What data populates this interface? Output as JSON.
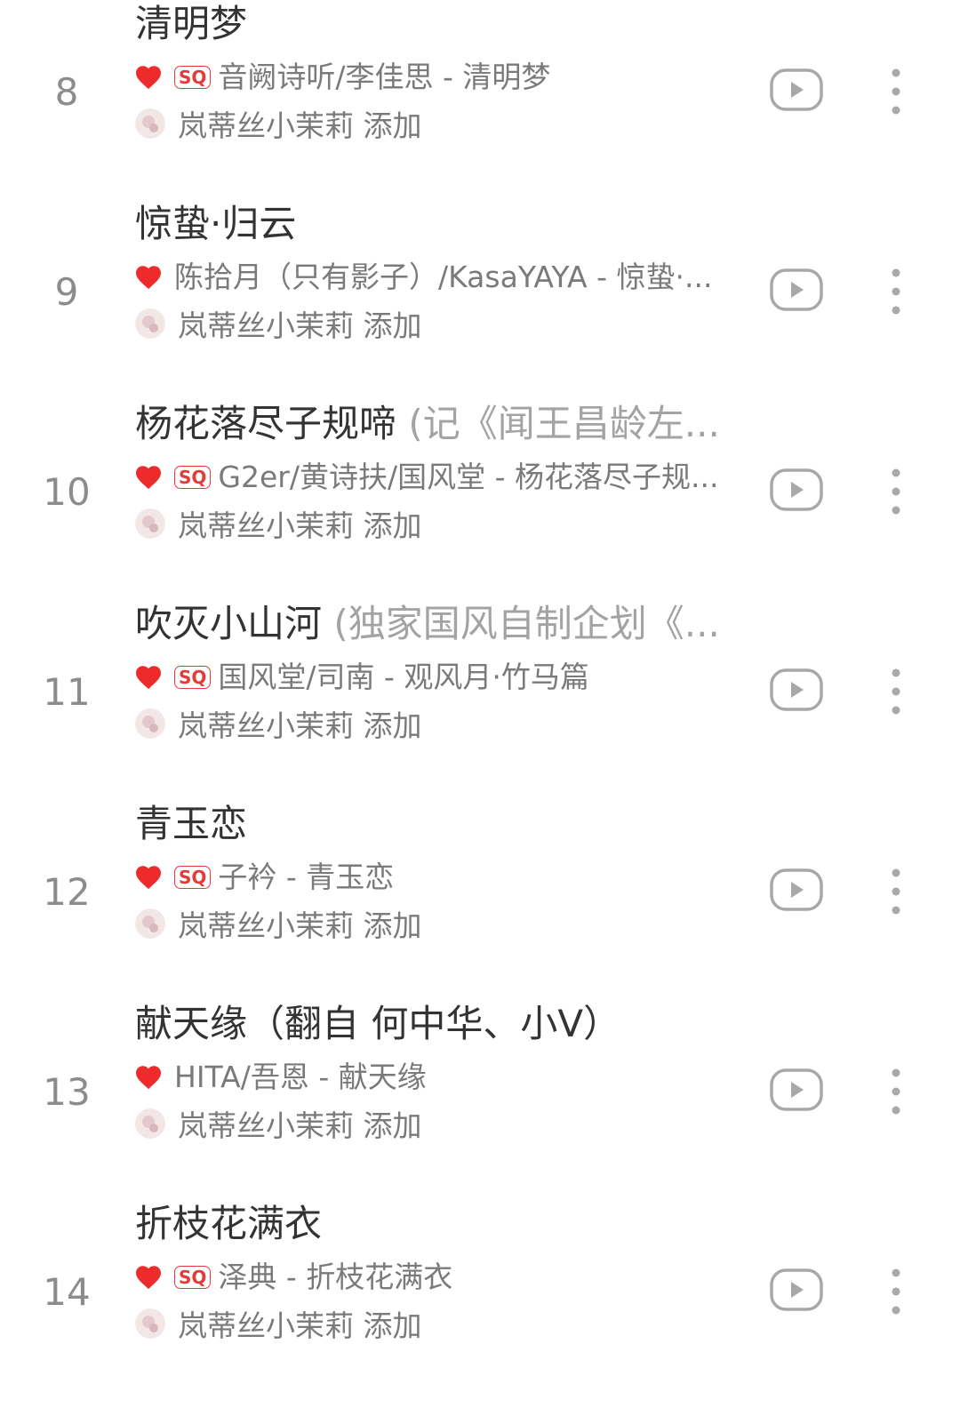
{
  "songs": [
    {
      "index": "8",
      "title": "清明梦",
      "subtitle": "",
      "sq": true,
      "artist": "音阙诗听/李佳思 - 清明梦",
      "added_by": "岚蒂丝小茉莉",
      "added_label": "添加"
    },
    {
      "index": "9",
      "title": "惊蛰·归云",
      "subtitle": "",
      "sq": false,
      "artist": "陈拾月（只有影子）/KasaYAYA - 惊蛰·...",
      "added_by": "岚蒂丝小茉莉",
      "added_label": "添加"
    },
    {
      "index": "10",
      "title": "杨花落尽子规啼",
      "subtitle": "(记《闻王昌龄左...",
      "sq": true,
      "artist": "G2er/黄诗扶/国风堂 - 杨花落尽子规...",
      "added_by": "岚蒂丝小茉莉",
      "added_label": "添加"
    },
    {
      "index": "11",
      "title": "吹灭小山河",
      "subtitle": "(独家国风自制企划《...",
      "sq": true,
      "artist": "国风堂/司南 - 观风月·竹马篇",
      "added_by": "岚蒂丝小茉莉",
      "added_label": "添加"
    },
    {
      "index": "12",
      "title": "青玉恋",
      "subtitle": "",
      "sq": true,
      "artist": "子衿 - 青玉恋",
      "added_by": "岚蒂丝小茉莉",
      "added_label": "添加"
    },
    {
      "index": "13",
      "title": "献天缘（翻自 何中华、小V）",
      "subtitle": "",
      "sq": false,
      "artist": "HITA/吾恩 - 献天缘",
      "added_by": "岚蒂丝小茉莉",
      "added_label": "添加"
    },
    {
      "index": "14",
      "title": "折枝花满衣",
      "subtitle": "",
      "sq": true,
      "artist": "泽典 - 折枝花满衣",
      "added_by": "岚蒂丝小茉莉",
      "added_label": "添加"
    }
  ],
  "sq_label": "SQ",
  "icons": {
    "liked": "heart-icon",
    "play": "play-video-icon",
    "more": "more-vertical-icon"
  },
  "colors": {
    "heart": "#ee2b2b",
    "sq": "#e33a3a",
    "icon": "#a8a8a8",
    "text": "#333333",
    "secondary": "#7a7a7a"
  }
}
